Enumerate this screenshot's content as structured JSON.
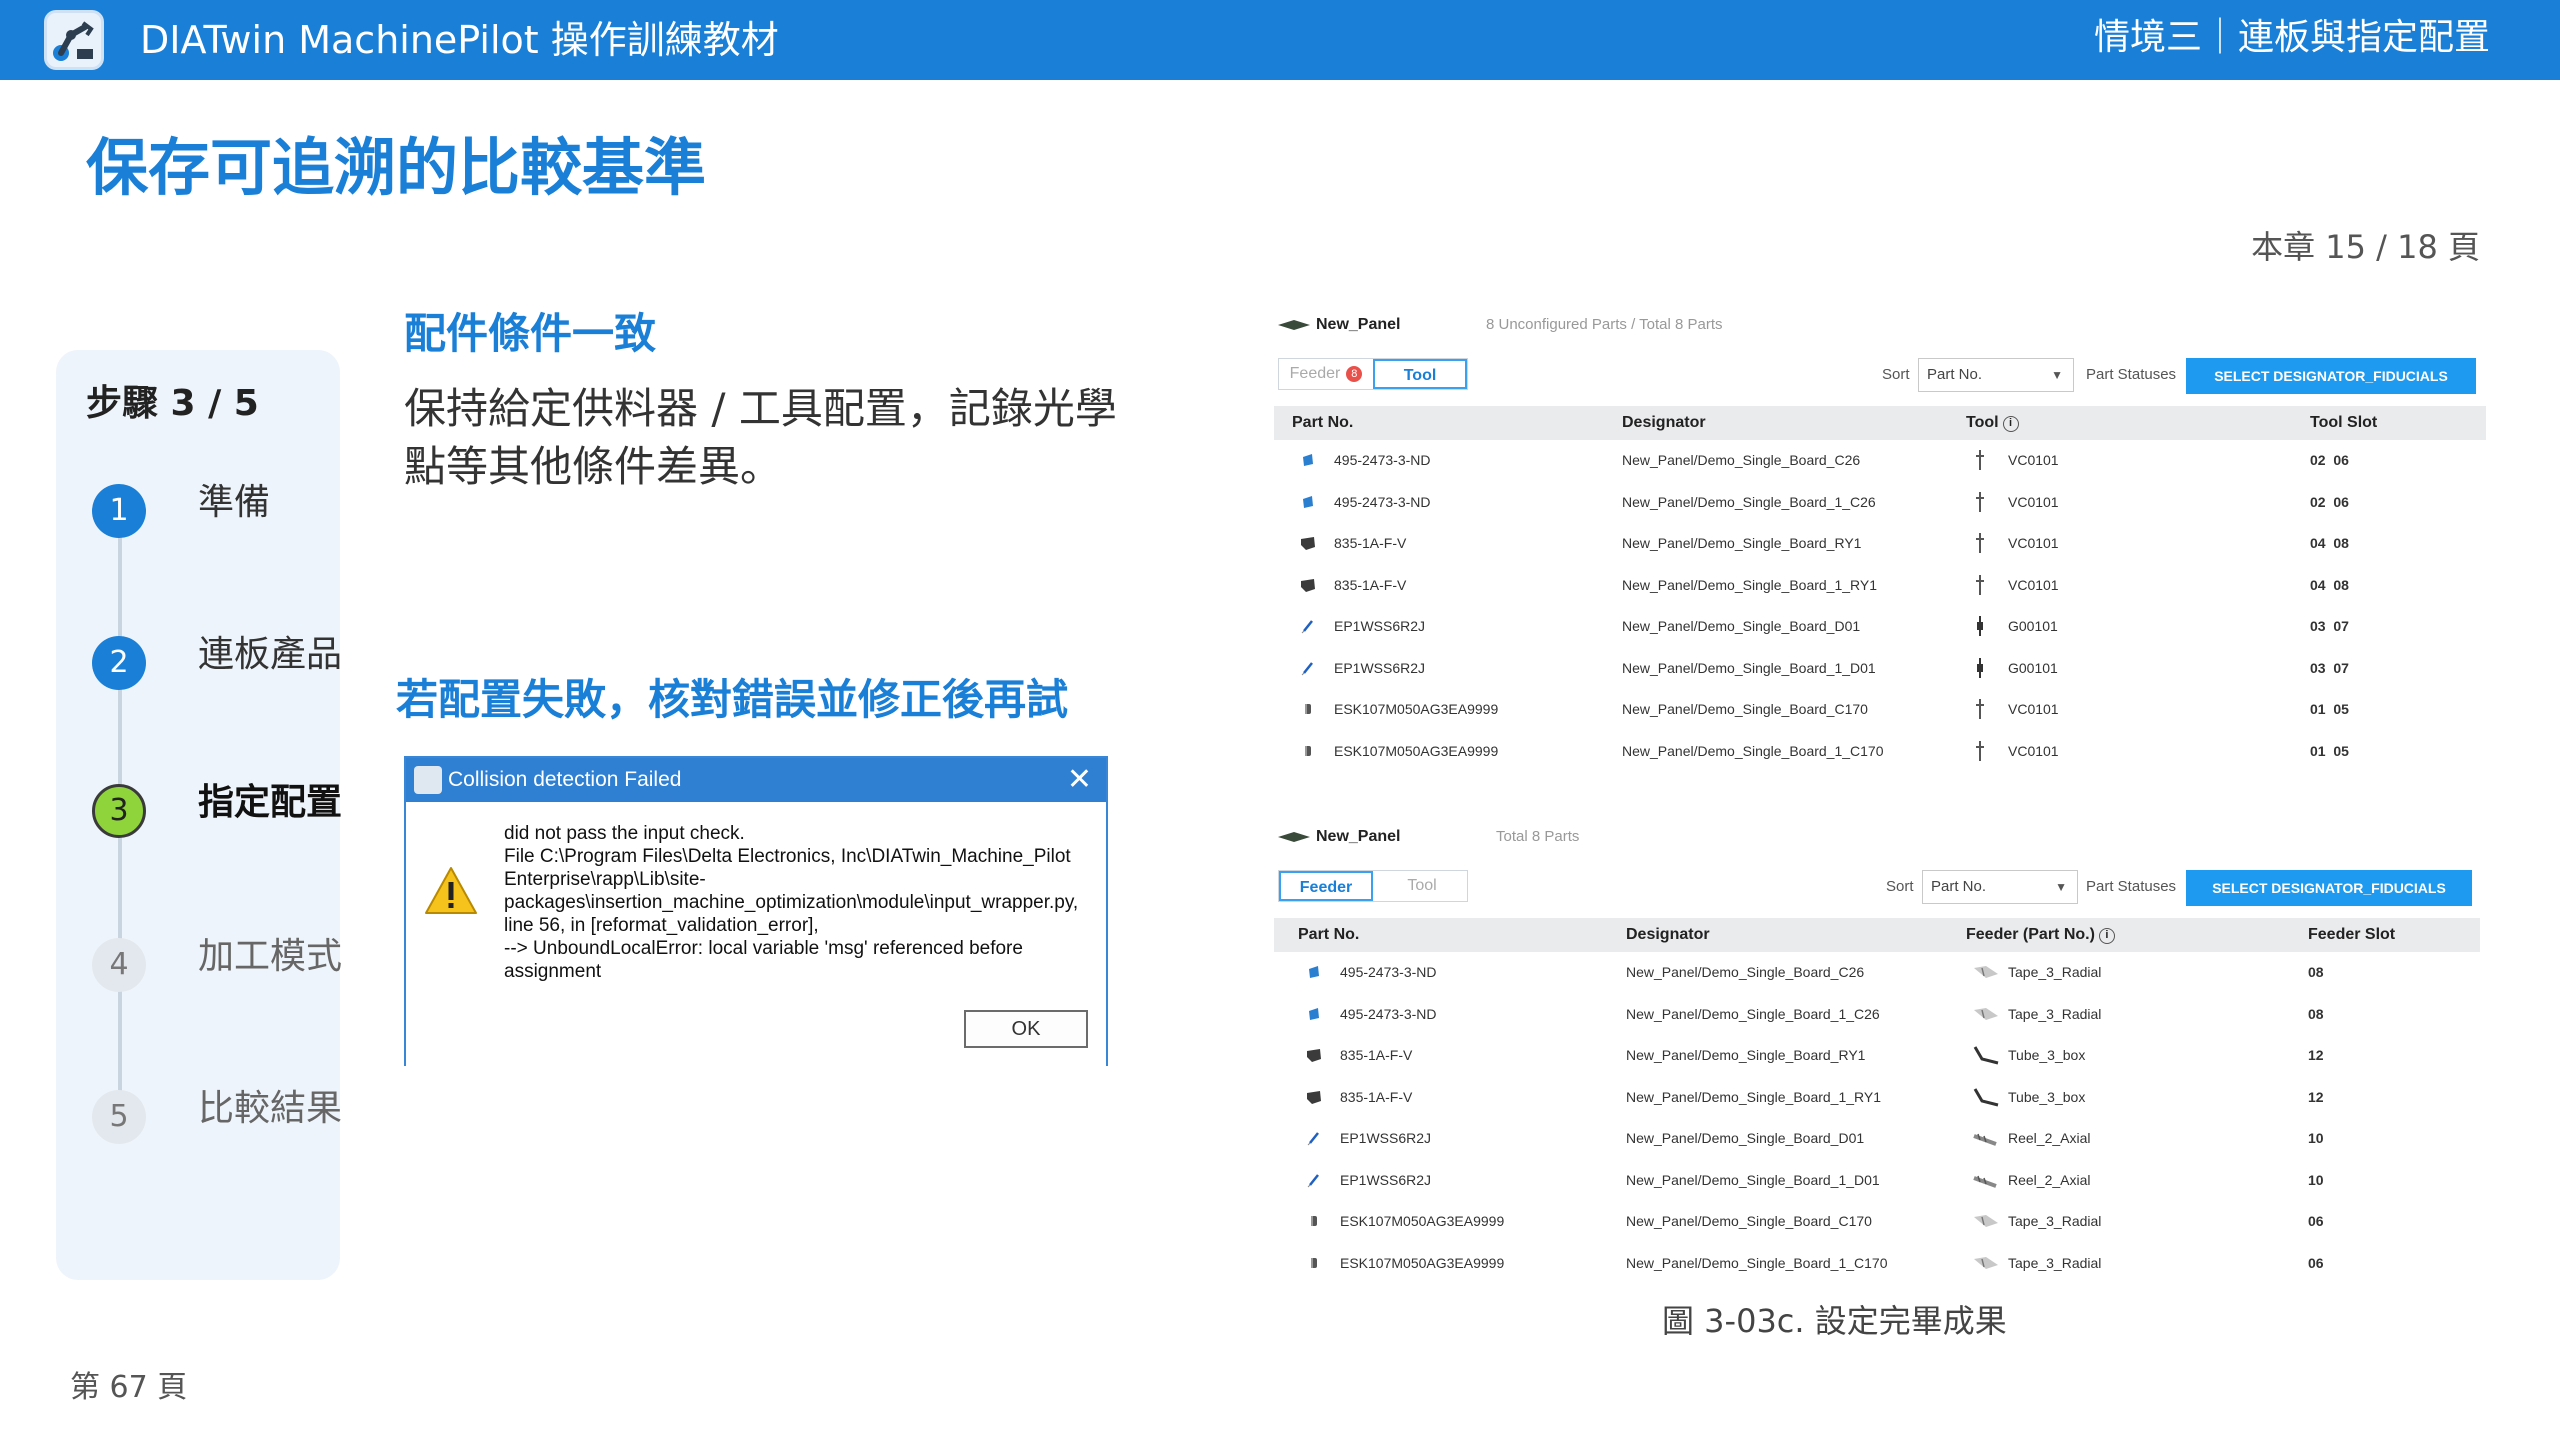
{
  "header": {
    "app_title": "DIATwin MachinePilot 操作訓練教材",
    "chapter": "情境三｜連板與指定配置",
    "logo_icon": "robot-arm-logo-icon"
  },
  "page_title": "保存可追溯的比較基準",
  "chapter_page": "本章 15 / 18 頁",
  "steps": {
    "counter": "步驟 3 / 5",
    "items": [
      {
        "num": "1",
        "label": "準備",
        "state": "done"
      },
      {
        "num": "2",
        "label": "連板產品",
        "state": "done"
      },
      {
        "num": "3",
        "label": "指定配置",
        "state": "current"
      },
      {
        "num": "4",
        "label": "加工模式",
        "state": "todo"
      },
      {
        "num": "5",
        "label": "比較結果",
        "state": "todo"
      }
    ]
  },
  "section1": {
    "title": "配件條件一致",
    "body": "保持給定供料器 / 工具配置，記錄光學點等其他條件差異。"
  },
  "section2": {
    "title": "若配置失敗，核對錯誤並修正後再試"
  },
  "dialog": {
    "title": "Collision detection Failed",
    "message": "did not pass the input check.\nFile C:\\Program Files\\Delta Electronics, Inc\\DIATwin_Machine_Pilot Enterprise\\rapp\\Lib\\site-packages\\insertion_machine_optimization\\module\\input_wrapper.py, line 56, in [reformat_validation_error],\n--> UnboundLocalError: local variable 'msg' referenced before assignment",
    "ok_label": "OK",
    "close_glyph": "✕"
  },
  "table_tool": {
    "panel_name": "New_Panel",
    "panel_info": "8 Unconfigured Parts / Total 8 Parts",
    "tab_feeder": "Feeder",
    "tab_feeder_badge": "8",
    "tab_tool": "Tool",
    "sort_label": "Sort",
    "sort_value": "Part No.",
    "statuses_label": "Part Statuses",
    "select_button": "SELECT DESIGNATOR_FIDUCIALS",
    "columns": [
      "Part No.",
      "Designator",
      "Tool",
      "Tool Slot"
    ],
    "rows": [
      {
        "part": "495-2473-3-ND",
        "designator": "New_Panel/Demo_Single_Board_C26",
        "tool": "VC0101",
        "slot": "02  06",
        "icon": "blue"
      },
      {
        "part": "495-2473-3-ND",
        "designator": "New_Panel/Demo_Single_Board_1_C26",
        "tool": "VC0101",
        "slot": "02  06",
        "icon": "blue"
      },
      {
        "part": "835-1A-F-V",
        "designator": "New_Panel/Demo_Single_Board_RY1",
        "tool": "VC0101",
        "slot": "04  08",
        "icon": "dark"
      },
      {
        "part": "835-1A-F-V",
        "designator": "New_Panel/Demo_Single_Board_1_RY1",
        "tool": "VC0101",
        "slot": "04  08",
        "icon": "dark"
      },
      {
        "part": "EP1WSS6R2J",
        "designator": "New_Panel/Demo_Single_Board_D01",
        "tool": "G00101",
        "slot": "03  07",
        "icon": "resistor"
      },
      {
        "part": "EP1WSS6R2J",
        "designator": "New_Panel/Demo_Single_Board_1_D01",
        "tool": "G00101",
        "slot": "03  07",
        "icon": "resistor"
      },
      {
        "part": "ESK107M050AG3EA9999",
        "designator": "New_Panel/Demo_Single_Board_C170",
        "tool": "VC0101",
        "slot": "01  05",
        "icon": "cap"
      },
      {
        "part": "ESK107M050AG3EA9999",
        "designator": "New_Panel/Demo_Single_Board_1_C170",
        "tool": "VC0101",
        "slot": "01  05",
        "icon": "cap"
      }
    ]
  },
  "table_feeder": {
    "panel_name": "New_Panel",
    "panel_info": "Total 8 Parts",
    "tab_feeder": "Feeder",
    "tab_tool": "Tool",
    "sort_label": "Sort",
    "sort_value": "Part No.",
    "statuses_label": "Part Statuses",
    "select_button": "SELECT DESIGNATOR_FIDUCIALS",
    "columns": [
      "Part No.",
      "Designator",
      "Feeder (Part No.)",
      "Feeder Slot"
    ],
    "rows": [
      {
        "part": "495-2473-3-ND",
        "designator": "New_Panel/Demo_Single_Board_C26",
        "feeder": "Tape_3_Radial",
        "slot": "08",
        "icon": "blue",
        "ficon": "tape"
      },
      {
        "part": "495-2473-3-ND",
        "designator": "New_Panel/Demo_Single_Board_1_C26",
        "feeder": "Tape_3_Radial",
        "slot": "08",
        "icon": "blue",
        "ficon": "tape"
      },
      {
        "part": "835-1A-F-V",
        "designator": "New_Panel/Demo_Single_Board_RY1",
        "feeder": "Tube_3_box",
        "slot": "12",
        "icon": "dark",
        "ficon": "tube"
      },
      {
        "part": "835-1A-F-V",
        "designator": "New_Panel/Demo_Single_Board_1_RY1",
        "feeder": "Tube_3_box",
        "slot": "12",
        "icon": "dark",
        "ficon": "tube"
      },
      {
        "part": "EP1WSS6R2J",
        "designator": "New_Panel/Demo_Single_Board_D01",
        "feeder": "Reel_2_Axial",
        "slot": "10",
        "icon": "resistor",
        "ficon": "reel"
      },
      {
        "part": "EP1WSS6R2J",
        "designator": "New_Panel/Demo_Single_Board_1_D01",
        "feeder": "Reel_2_Axial",
        "slot": "10",
        "icon": "resistor",
        "ficon": "reel"
      },
      {
        "part": "ESK107M050AG3EA9999",
        "designator": "New_Panel/Demo_Single_Board_C170",
        "feeder": "Tape_3_Radial",
        "slot": "06",
        "icon": "cap",
        "ficon": "tape"
      },
      {
        "part": "ESK107M050AG3EA9999",
        "designator": "New_Panel/Demo_Single_Board_1_C170",
        "feeder": "Tape_3_Radial",
        "slot": "06",
        "icon": "cap",
        "ficon": "tape"
      }
    ]
  },
  "figure_caption": "圖 3-03c. 設定完畢成果",
  "page_number": "第 67 頁",
  "colors": {
    "brand": "#1a7fd6",
    "step_current": "#8ed43a",
    "select_button": "#1e9af0",
    "badge": "#e9504a"
  }
}
